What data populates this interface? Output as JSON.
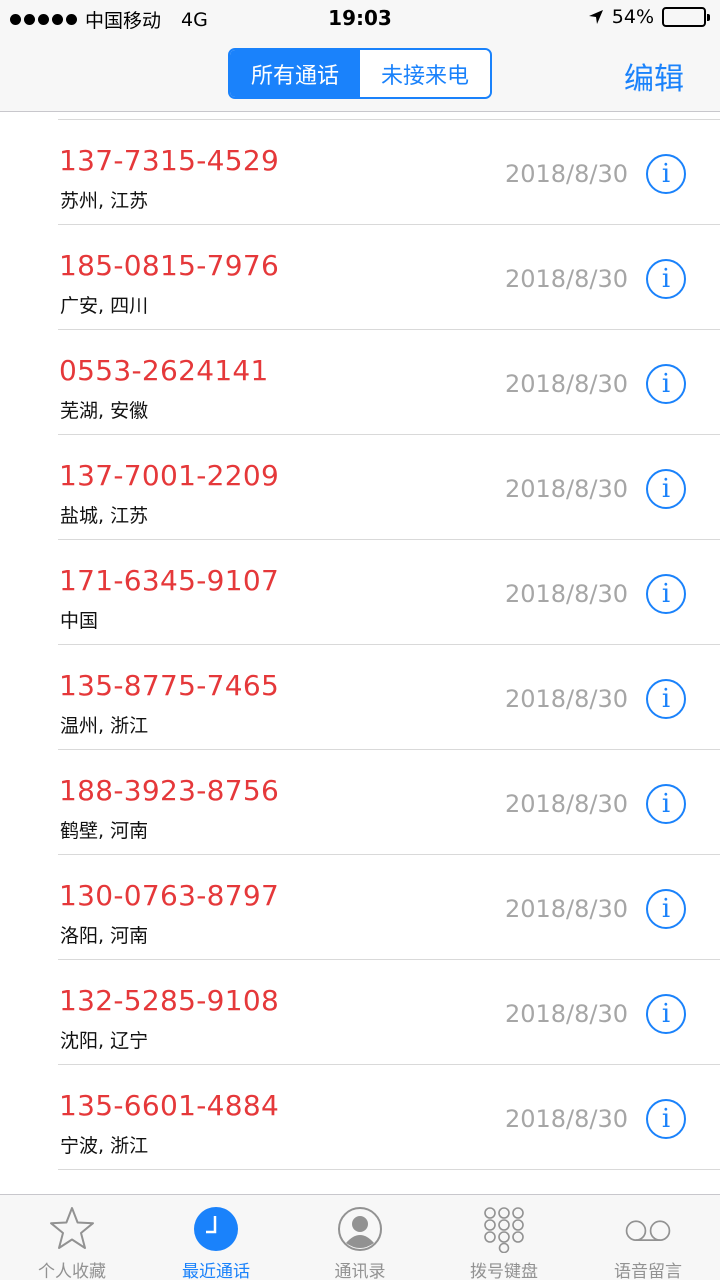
{
  "status_bar": {
    "carrier": "中国移动",
    "network": "4G",
    "time": "19:03",
    "battery_text": "54%",
    "battery_level": 0.54
  },
  "nav": {
    "segments": [
      "所有通话",
      "未接来电"
    ],
    "active_segment": 0,
    "edit_label": "编辑"
  },
  "calls": [
    {
      "number": "137-7315-4529",
      "location": "苏州, 江苏",
      "date": "2018/8/30"
    },
    {
      "number": "185-0815-7976",
      "location": "广安, 四川",
      "date": "2018/8/30"
    },
    {
      "number": "0553-2624141",
      "location": "芜湖, 安徽",
      "date": "2018/8/30"
    },
    {
      "number": "137-7001-2209",
      "location": "盐城, 江苏",
      "date": "2018/8/30"
    },
    {
      "number": "171-6345-9107",
      "location": "中国",
      "date": "2018/8/30"
    },
    {
      "number": "135-8775-7465",
      "location": "温州, 浙江",
      "date": "2018/8/30"
    },
    {
      "number": "188-3923-8756",
      "location": "鹤壁, 河南",
      "date": "2018/8/30"
    },
    {
      "number": "130-0763-8797",
      "location": "洛阳, 河南",
      "date": "2018/8/30"
    },
    {
      "number": "132-5285-9108",
      "location": "沈阳, 辽宁",
      "date": "2018/8/30"
    },
    {
      "number": "135-6601-4884",
      "location": "宁波, 浙江",
      "date": "2018/8/30"
    }
  ],
  "info_glyph": "i",
  "tabs": [
    {
      "label": "个人收藏",
      "icon": "star-icon"
    },
    {
      "label": "最近通话",
      "icon": "clock-icon"
    },
    {
      "label": "通讯录",
      "icon": "contacts-icon"
    },
    {
      "label": "拨号键盘",
      "icon": "keypad-icon"
    },
    {
      "label": "语音留言",
      "icon": "voicemail-icon"
    }
  ],
  "active_tab": 1,
  "colors": {
    "accent": "#1a82fb",
    "missed_call": "#e5383a",
    "date_gray": "#a6a6a6",
    "tab_inactive": "#929292"
  }
}
